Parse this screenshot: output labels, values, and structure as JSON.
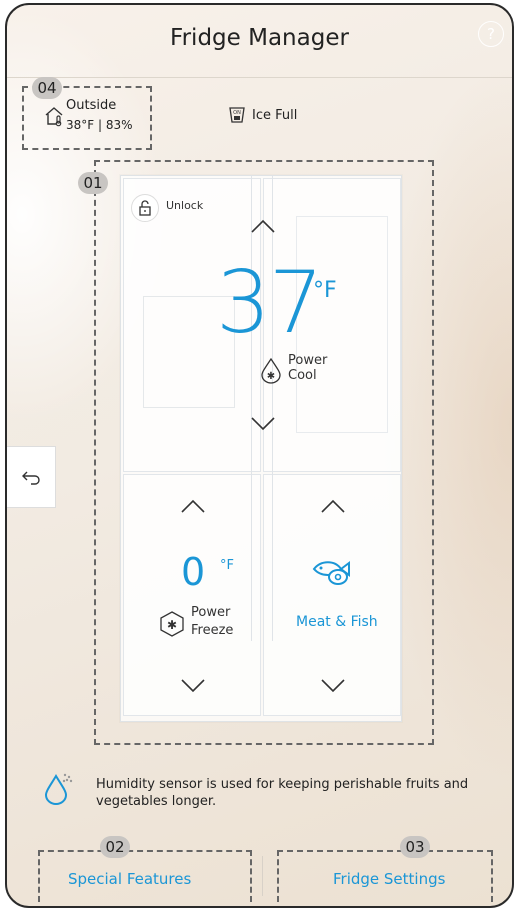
{
  "app_title": "Fridge Manager",
  "help_label": "?",
  "outside": {
    "label": "Outside",
    "value": "38°F | 83%",
    "badge": "04"
  },
  "ice_status": "Ice Full",
  "fridge_badge": "01",
  "lock": {
    "label": "Unlock"
  },
  "fridge_compartment": {
    "temp": "37",
    "unit": "°F",
    "mode_line1": "Power",
    "mode_line2": "Cool"
  },
  "freezer_compartment": {
    "temp": "0",
    "unit": "°F",
    "mode_line1": "Power",
    "mode_line2": "Freeze"
  },
  "flex_compartment": {
    "mode": "Meat & Fish"
  },
  "info_text": "Humidity sensor is used for keeping perishable fruits and vegetables longer.",
  "bottom": {
    "special_features": {
      "label": "Special Features",
      "badge": "02"
    },
    "fridge_settings": {
      "label": "Fridge Settings",
      "badge": "03"
    }
  },
  "colors": {
    "accent": "#1b96d6"
  }
}
